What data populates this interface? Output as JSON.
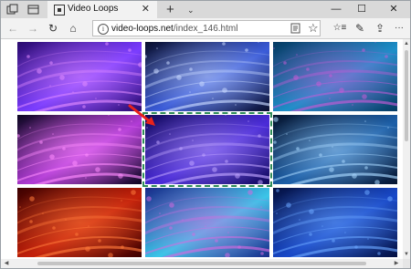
{
  "browser": {
    "tab_title": "Video Loops",
    "tab_close": "✕",
    "new_tab": "+",
    "tab_list": "⌄",
    "window_minimize": "—",
    "window_maximize": "☐",
    "window_close": "✕"
  },
  "nav": {
    "back": "←",
    "forward": "→",
    "refresh": "↻",
    "home": "⌂",
    "url_host": "video-loops.net",
    "url_path": "/index_146.html",
    "favorite": "☆",
    "favorites_hub": "☆≡",
    "notes": "✎",
    "share": "⇪",
    "more": "···"
  },
  "gallery": {
    "selected_index": 4,
    "thumbnails": [
      {
        "label": "purple-wave-streaks",
        "colors": [
          "#2a0b6e",
          "#7a3cff",
          "#e08bff"
        ]
      },
      {
        "label": "blue-particle-lines",
        "colors": [
          "#0a0f2e",
          "#3a5bd9",
          "#c8d8ff"
        ]
      },
      {
        "label": "teal-curve-gradient",
        "colors": [
          "#063a63",
          "#1e8fc9",
          "#c45bd6"
        ]
      },
      {
        "label": "pink-ring-tunnel",
        "colors": [
          "#0b0620",
          "#b13bd6",
          "#ff8cff"
        ]
      },
      {
        "label": "violet-dust-field",
        "colors": [
          "#120a5c",
          "#4a2bd8",
          "#bfa4ff"
        ]
      },
      {
        "label": "blue-cloud-particles",
        "colors": [
          "#06142e",
          "#1c5fa8",
          "#a9d8ff"
        ]
      },
      {
        "label": "red-swirl",
        "colors": [
          "#3b0000",
          "#c4200a",
          "#ff7a3a"
        ]
      },
      {
        "label": "cyan-bokeh-lights",
        "colors": [
          "#1a2a8a",
          "#3bc6e8",
          "#d46ae0"
        ]
      },
      {
        "label": "deep-blue-streaks",
        "colors": [
          "#041040",
          "#1848c8",
          "#6aa6ff"
        ]
      }
    ]
  },
  "annotation": {
    "arrow_color": "#e8221b",
    "frame_color": "#2e8b57"
  }
}
